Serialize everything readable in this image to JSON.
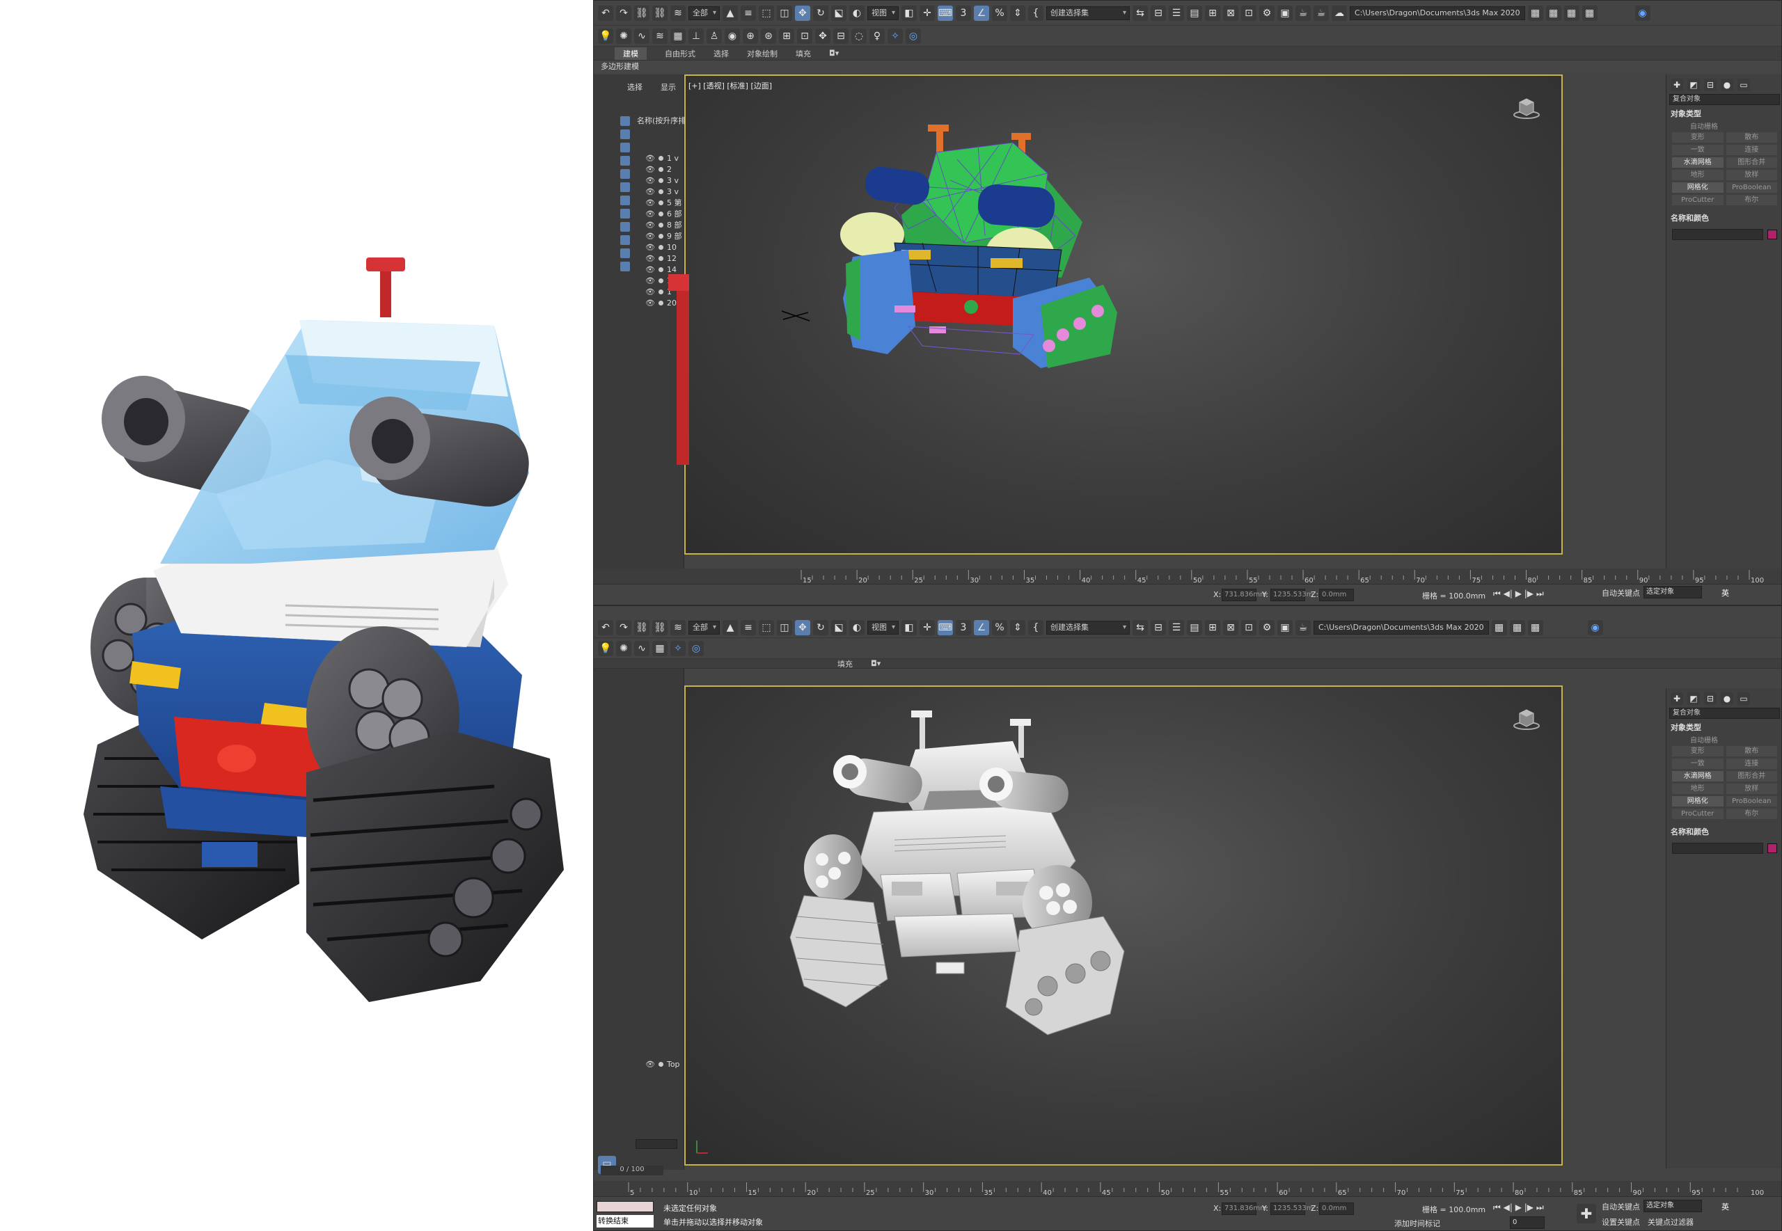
{
  "toolbar": {
    "filter_dropdown": "全部",
    "view_dropdown": "视图",
    "selection_set_dropdown": "创建选择集",
    "project_path": "C:\\Users\\Dragon\\Documents\\3ds Max 2020",
    "angle_snap": "3",
    "percent_snap": "%"
  },
  "ribbon": {
    "tabs": [
      "建模",
      "自由形式",
      "选择",
      "对象绘制",
      "填充"
    ],
    "active_tab_index": 0,
    "subtitle": "多边形建模"
  },
  "scene_explorer": {
    "tab_select": "选择",
    "tab_display": "显示",
    "column_name": "名称(按升序排",
    "rows_top": [
      "1 v",
      "2",
      "3 v",
      "3 v",
      "5 第",
      "6 部",
      "8 部",
      "9 部",
      "10",
      "12",
      "14",
      "16",
      "1",
      "20"
    ],
    "rows_bottom": [
      "Top"
    ],
    "scroll_value": "0 / 100"
  },
  "viewport_label": "[+] [透视] [标准] [边面]",
  "command_panel": {
    "category_dropdown": "复合对象",
    "object_type_header": "对象类型",
    "auto_grid": "自动栅格",
    "buttons": [
      "变形",
      "散布",
      "一致",
      "连接",
      "水滴网格",
      "图形合并",
      "地形",
      "放样",
      "网格化",
      "ProBoolean",
      "ProCutter",
      "布尔"
    ],
    "lit_buttons": [
      "水滴网格",
      "网格化"
    ],
    "name_color_header": "名称和颜色",
    "object_color": "#b0226a"
  },
  "timeline": {
    "ticks_top": [
      "15",
      "20",
      "25",
      "30",
      "35",
      "40",
      "45",
      "50",
      "55",
      "60",
      "65",
      "70",
      "75",
      "80",
      "85",
      "90",
      "95",
      "100"
    ],
    "ticks_bottom": [
      "5",
      "10",
      "15",
      "20",
      "25",
      "30",
      "35",
      "40",
      "45",
      "50",
      "55",
      "60",
      "65",
      "70",
      "75",
      "80",
      "85",
      "90",
      "95",
      "100"
    ],
    "frame_range": "0 / 100"
  },
  "status_bar": {
    "x_label": "X:",
    "x_value": "731.836mm",
    "y_label": "Y:",
    "y_value": "1235.533m",
    "z_label": "Z:",
    "z_value": "0.0mm",
    "grid": "栅格 = 100.0mm",
    "add_time_tag": "添加时间标记",
    "auto_key": "自动关键点",
    "selected_dropdown": "选定对象",
    "set_key": "设置关键点",
    "key_filters": "关键点过滤器",
    "frame_value": "0",
    "status_line1": "未选定任何对象",
    "status_line2": "单击并拖动以选择并移动对象",
    "script_label": "转换结束",
    "ime": "英"
  },
  "colors": {
    "viewport_border": "#c9b34a",
    "ui_bg": "#444444",
    "accent_blue": "#5a7fae"
  }
}
